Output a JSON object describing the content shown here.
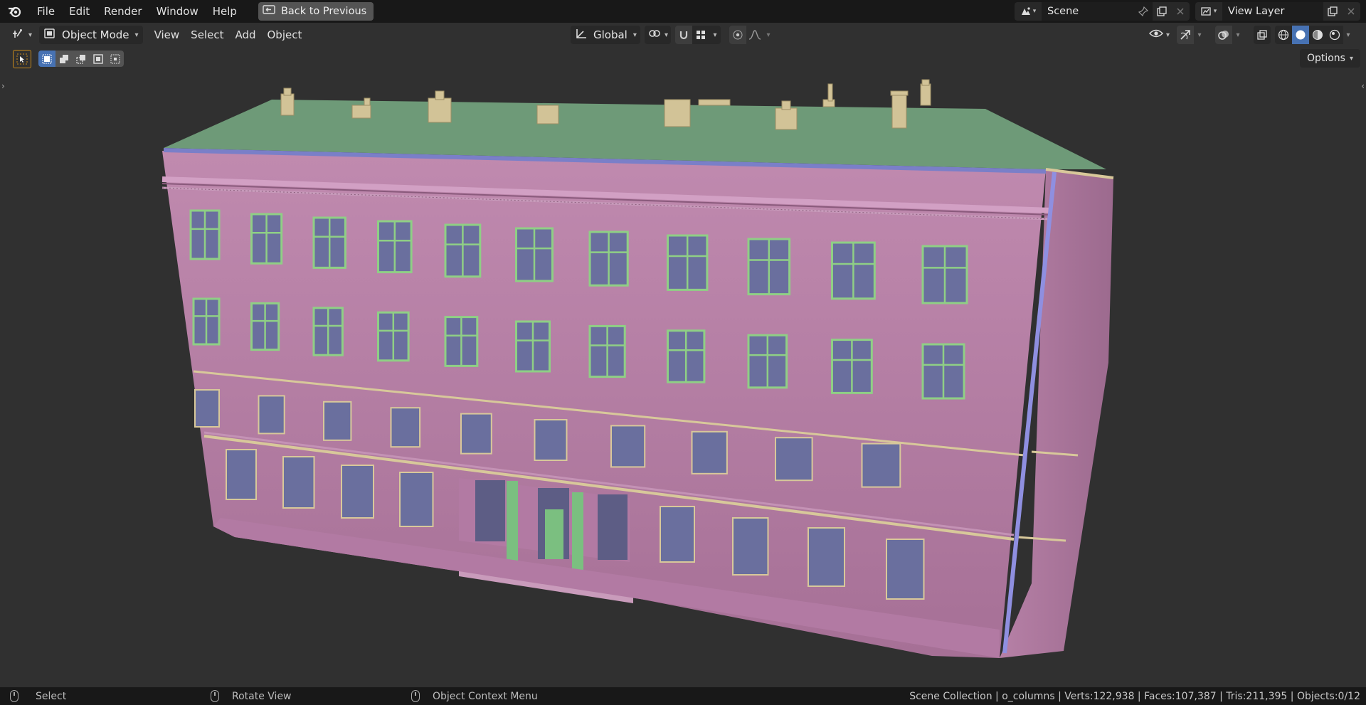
{
  "topbar": {
    "menu": [
      "File",
      "Edit",
      "Render",
      "Window",
      "Help"
    ],
    "back_button": "Back to Previous",
    "scene_name": "Scene",
    "view_layer_name": "View Layer"
  },
  "header": {
    "mode": "Object Mode",
    "menus": [
      "View",
      "Select",
      "Add",
      "Object"
    ],
    "transform_orientation": "Global",
    "options_label": "Options"
  },
  "statusbar": {
    "hint_left": "Select",
    "hint_middle": "Rotate View",
    "hint_right": "Object Context Menu",
    "stats": "Scene Collection | o_columns | Verts:122,938 | Faces:107,387 | Tris:211,395 | Objects:0/12"
  },
  "colors": {
    "wall": "#b77ea7",
    "roof": "#6e9a78",
    "window_glass": "#6a6f9e",
    "window_frame": "#8fcf85",
    "trim": "#d8c89a",
    "chimney": "#d2c397",
    "accent_active": "#4772b3"
  }
}
